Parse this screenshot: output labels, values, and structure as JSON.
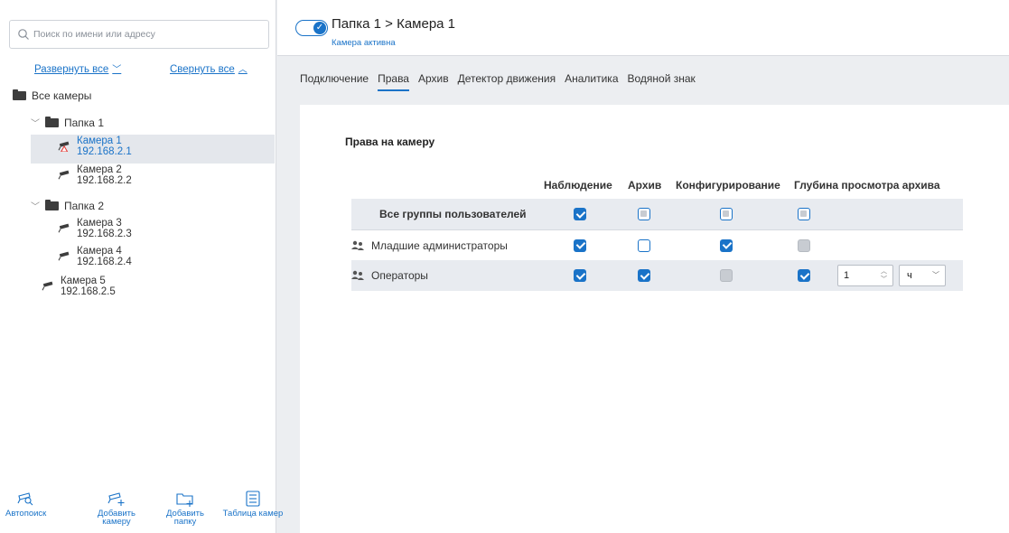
{
  "sidebar": {
    "search_placeholder": "Поиск по имени или адресу",
    "expand_all": "Развернуть все",
    "collapse_all": "Свернуть все",
    "all_cameras": "Все камеры",
    "folders": [
      {
        "name": "Папка 1",
        "cameras": [
          {
            "name": "Камера 1",
            "ip": "192.168.2.1",
            "selected": true,
            "warning": true
          },
          {
            "name": "Камера 2",
            "ip": "192.168.2.2"
          }
        ]
      },
      {
        "name": "Папка 2",
        "cameras": [
          {
            "name": "Камера 3",
            "ip": "192.168.2.3"
          },
          {
            "name": "Камера 4",
            "ip": "192.168.2.4"
          }
        ]
      }
    ],
    "root_cameras": [
      {
        "name": "Камера 5",
        "ip": "192.168.2.5"
      }
    ],
    "tools": {
      "autosearch": "Автопоиск",
      "add_camera_1": "Добавить",
      "add_camera_2": "камеру",
      "add_folder_1": "Добавить",
      "add_folder_2": "папку",
      "camera_table": "Таблица камер"
    }
  },
  "header": {
    "breadcrumb": "Папка 1 > Камера 1",
    "status": "Камера активна"
  },
  "tabs": [
    "Подключение",
    "Права",
    "Архив",
    "Детектор движения",
    "Аналитика",
    "Водяной знак"
  ],
  "active_tab": "Права",
  "permissions": {
    "title": "Права на камеру",
    "columns": {
      "observation": "Наблюдение",
      "archive": "Архив",
      "configuration": "Конфигурирование",
      "depth": "Глубина просмотра архива"
    },
    "rows": [
      {
        "name": "Все группы пользователей",
        "observation": "on",
        "archive": "indeterminate",
        "configuration": "indeterminate",
        "depth": "indeterminate"
      },
      {
        "name": "Младшие администраторы",
        "observation": "on",
        "archive": "off",
        "configuration": "on",
        "depth": "disabled"
      },
      {
        "name": "Операторы",
        "observation": "on",
        "archive": "on",
        "configuration": "disabled",
        "depth": "on",
        "depth_value": "1",
        "depth_unit": "ч"
      }
    ]
  },
  "colors": {
    "accent": "#1a73c8",
    "selected_row": "#e4e7ec",
    "background": "#eceef1"
  }
}
